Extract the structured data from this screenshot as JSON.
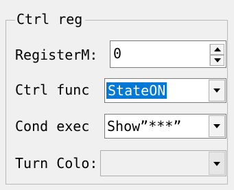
{
  "group": {
    "title": "Ctrl reg"
  },
  "rows": [
    {
      "label": "RegisterM:",
      "value": "0",
      "control": "spin-box"
    },
    {
      "label": "Ctrl func",
      "value": "StateON",
      "control": "combo-box"
    },
    {
      "label": "Cond exec",
      "value": "Show”***”",
      "control": "combo-box"
    },
    {
      "label": "Turn Colo:",
      "value": "",
      "control": "combo-box",
      "enabled": false
    }
  ],
  "icons": {
    "spin_up": "spin-up-arrow-icon",
    "spin_down": "spin-down-arrow-icon",
    "dropdown": "dropdown-arrow-icon"
  },
  "colors": {
    "background": "#f0f0f0",
    "selection": "#0078d7",
    "field_border": "#7a7a7a"
  }
}
